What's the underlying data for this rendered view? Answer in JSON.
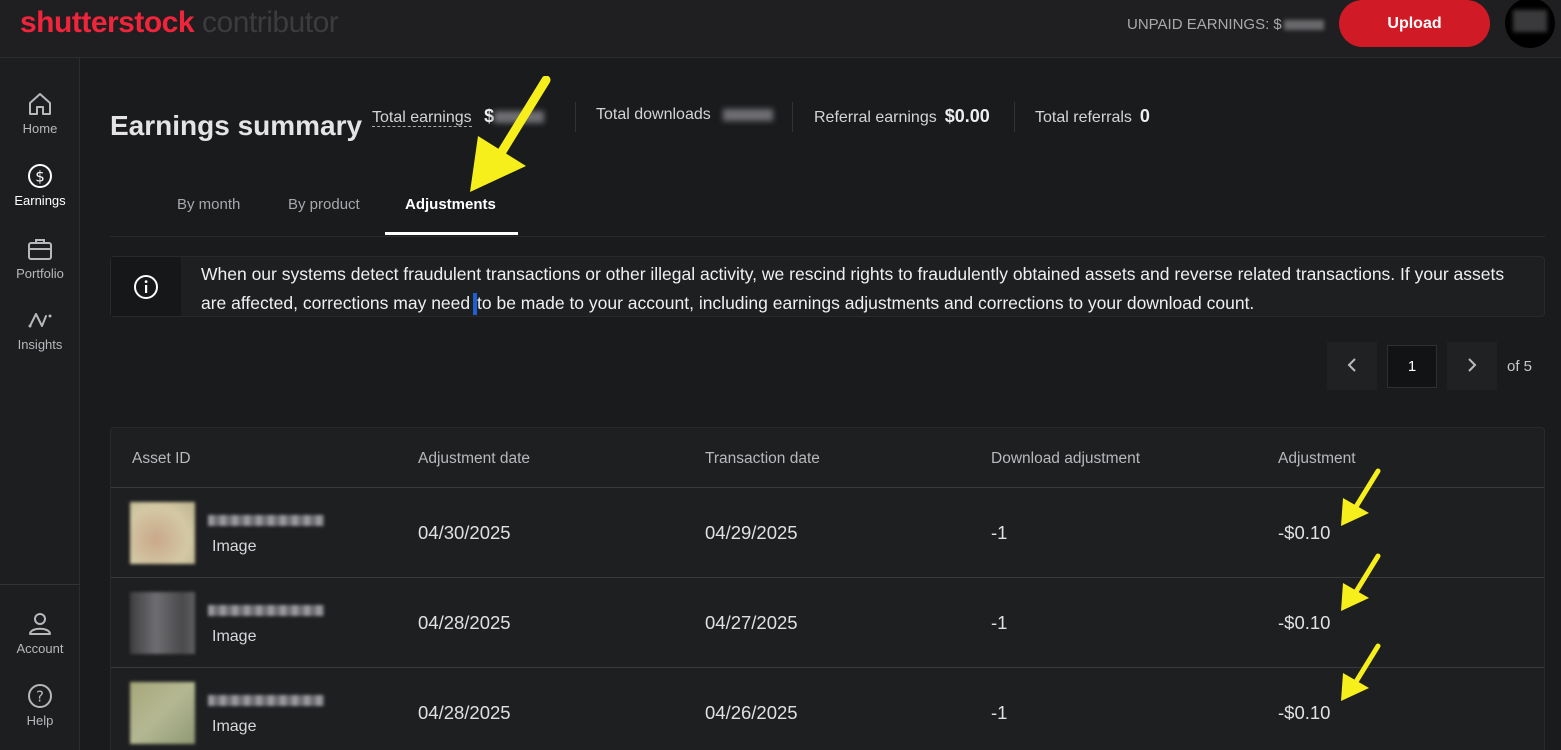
{
  "header": {
    "logo_brand": "shutterstock",
    "logo_sub": "contributor",
    "unpaid_label": "UNPAID EARNINGS: $",
    "upload_label": "Upload"
  },
  "sidebar": {
    "items": [
      {
        "label": "Home",
        "icon": "home-icon"
      },
      {
        "label": "Earnings",
        "icon": "dollar-circle-icon"
      },
      {
        "label": "Portfolio",
        "icon": "briefcase-icon"
      },
      {
        "label": "Insights",
        "icon": "insights-icon"
      },
      {
        "label": "Account",
        "icon": "user-icon"
      },
      {
        "label": "Help",
        "icon": "help-icon"
      }
    ]
  },
  "summary": {
    "title": "Earnings summary",
    "total_earnings_label": "Total earnings",
    "total_earnings_prefix": "$",
    "total_downloads_label": "Total downloads",
    "referral_earnings_label": "Referral earnings",
    "referral_earnings_value": "$0.00",
    "total_referrals_label": "Total referrals",
    "total_referrals_value": "0"
  },
  "tabs": [
    {
      "label": "By month",
      "active": false
    },
    {
      "label": "By product",
      "active": false
    },
    {
      "label": "Adjustments",
      "active": true
    }
  ],
  "banner": {
    "text_before": "When our systems detect fraudulent transactions or other illegal activity, we rescind rights to fraudulently obtained assets and reverse related transactions. If your assets are affected, corrections may need",
    "text_after": "to be made to your account, including earnings adjustments and corrections to your download count."
  },
  "pagination": {
    "current_page": "1",
    "of_label": "of 5"
  },
  "table": {
    "columns": [
      "Asset ID",
      "Adjustment date",
      "Transaction date",
      "Download adjustment",
      "Adjustment"
    ],
    "rows": [
      {
        "type": "Image",
        "adjustment_date": "04/30/2025",
        "transaction_date": "04/29/2025",
        "download_adjustment": "-1",
        "adjustment": "-$0.10",
        "thumb_color": "#cbbf9e"
      },
      {
        "type": "Image",
        "adjustment_date": "04/28/2025",
        "transaction_date": "04/27/2025",
        "download_adjustment": "-1",
        "adjustment": "-$0.10",
        "thumb_color": "#5a5a5c"
      },
      {
        "type": "Image",
        "adjustment_date": "04/28/2025",
        "transaction_date": "04/26/2025",
        "download_adjustment": "-1",
        "adjustment": "-$0.10",
        "thumb_color": "#a6b08a"
      }
    ]
  },
  "colors": {
    "brand_red": "#f0243a",
    "upload_red": "#d01a26",
    "annotation_yellow": "#f7ef1c",
    "cursor_blue": "#1f5fd6"
  }
}
